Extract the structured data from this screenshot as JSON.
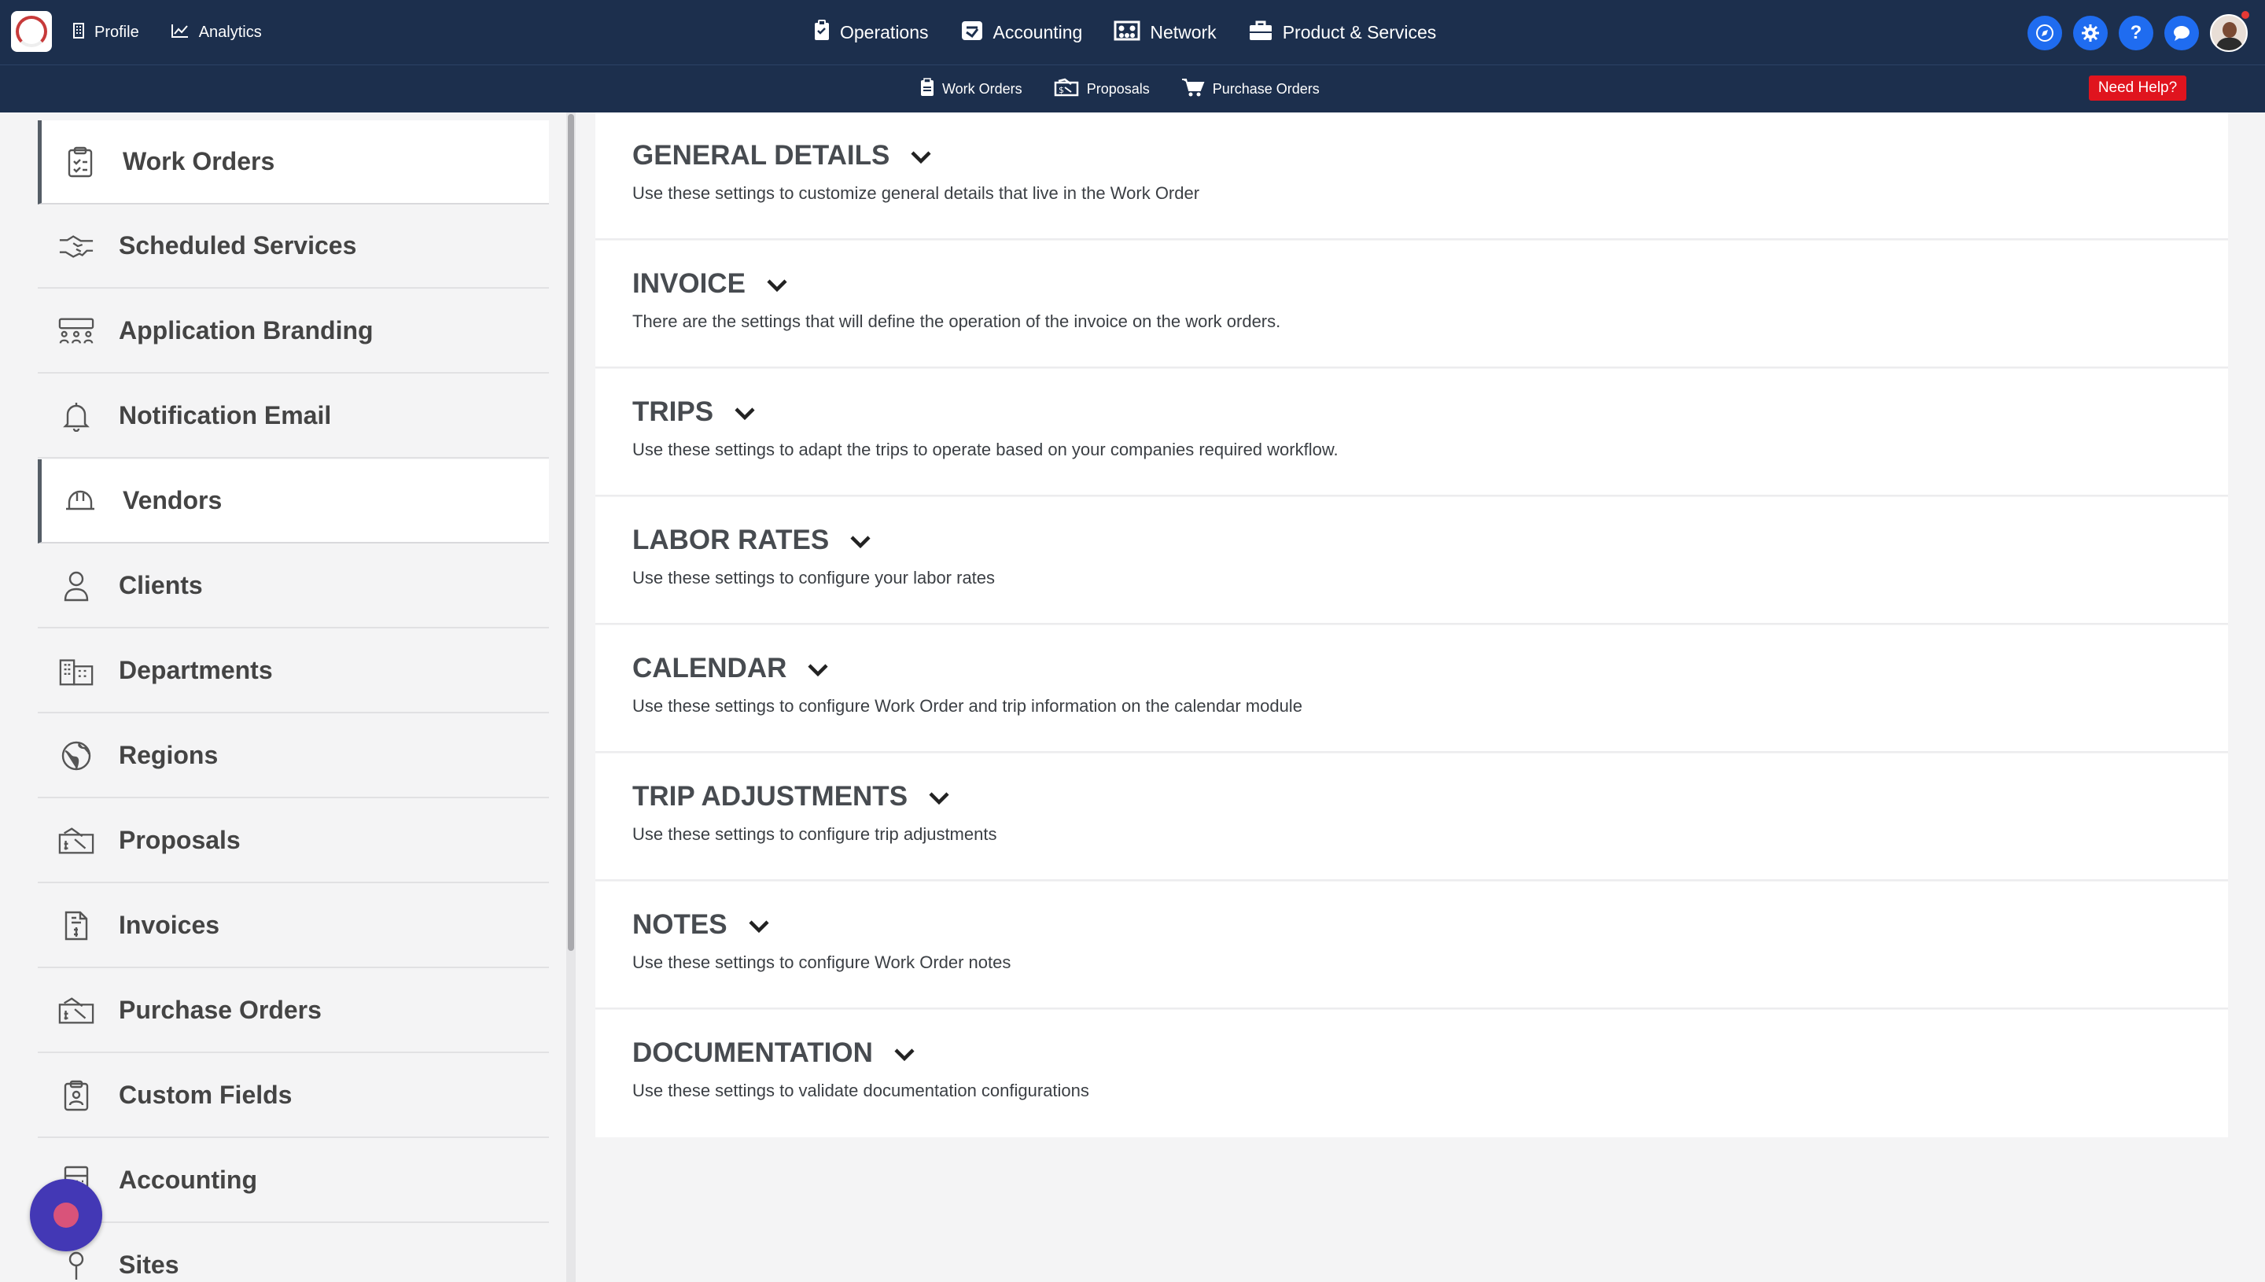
{
  "topbar": {
    "left_items": [
      {
        "label": "Profile",
        "icon": "building-icon"
      },
      {
        "label": "Analytics",
        "icon": "chart-line-icon"
      }
    ],
    "center_items": [
      {
        "label": "Operations",
        "icon": "clipboard-icon"
      },
      {
        "label": "Accounting",
        "icon": "calculator-icon"
      },
      {
        "label": "Network",
        "icon": "network-icon"
      },
      {
        "label": "Product & Services",
        "icon": "briefcase-icon"
      }
    ],
    "right_icons": [
      "compass-icon",
      "gear-icon",
      "help-icon",
      "chat-icon",
      "avatar"
    ],
    "help_symbol": "?"
  },
  "subbar": {
    "items": [
      {
        "label": "Work Orders",
        "icon": "clipboard-icon"
      },
      {
        "label": "Proposals",
        "icon": "proposal-icon"
      },
      {
        "label": "Purchase Orders",
        "icon": "cart-icon"
      }
    ],
    "help_button": "Need Help?"
  },
  "sidebar": {
    "items": [
      {
        "label": "Work Orders",
        "icon": "clipboard-check-icon",
        "active": true
      },
      {
        "label": "Scheduled Services",
        "icon": "handshake-icon",
        "active": false
      },
      {
        "label": "Application Branding",
        "icon": "people-group-icon",
        "active": false
      },
      {
        "label": "Notification Email",
        "icon": "bell-icon",
        "active": false
      },
      {
        "label": "Vendors",
        "icon": "hard-hat-icon",
        "active": true
      },
      {
        "label": "Clients",
        "icon": "user-icon",
        "active": false
      },
      {
        "label": "Departments",
        "icon": "buildings-icon",
        "active": false
      },
      {
        "label": "Regions",
        "icon": "globe-icon",
        "active": false
      },
      {
        "label": "Proposals",
        "icon": "proposal-icon",
        "active": false
      },
      {
        "label": "Invoices",
        "icon": "invoice-icon",
        "active": false
      },
      {
        "label": "Purchase Orders",
        "icon": "proposal-icon",
        "active": false
      },
      {
        "label": "Custom Fields",
        "icon": "clipboard-user-icon",
        "active": false
      },
      {
        "label": "Accounting",
        "icon": "calculator-icon",
        "active": false
      },
      {
        "label": "Sites",
        "icon": "map-pin-icon",
        "active": false
      }
    ]
  },
  "sections": [
    {
      "title": "GENERAL DETAILS",
      "desc": "Use these settings to customize general details that live in the Work Order"
    },
    {
      "title": "INVOICE",
      "desc": "There are the settings that will define the operation of the invoice on the work orders."
    },
    {
      "title": "TRIPS",
      "desc": "Use these settings to adapt the trips to operate based on your companies required workflow."
    },
    {
      "title": "LABOR RATES",
      "desc": "Use these settings to configure your labor rates"
    },
    {
      "title": "CALENDAR",
      "desc": "Use these settings to configure Work Order and trip information on the calendar module"
    },
    {
      "title": "TRIP ADJUSTMENTS",
      "desc": "Use these settings to configure trip adjustments"
    },
    {
      "title": "NOTES",
      "desc": "Use these settings to configure Work Order notes"
    },
    {
      "title": "DOCUMENTATION",
      "desc": "Use these settings to validate documentation configurations"
    }
  ],
  "colors": {
    "nav_bg": "#1c2f4d",
    "accent_blue": "#1f6cf0",
    "help_red": "#e0141e",
    "fab": "#4338b5"
  }
}
